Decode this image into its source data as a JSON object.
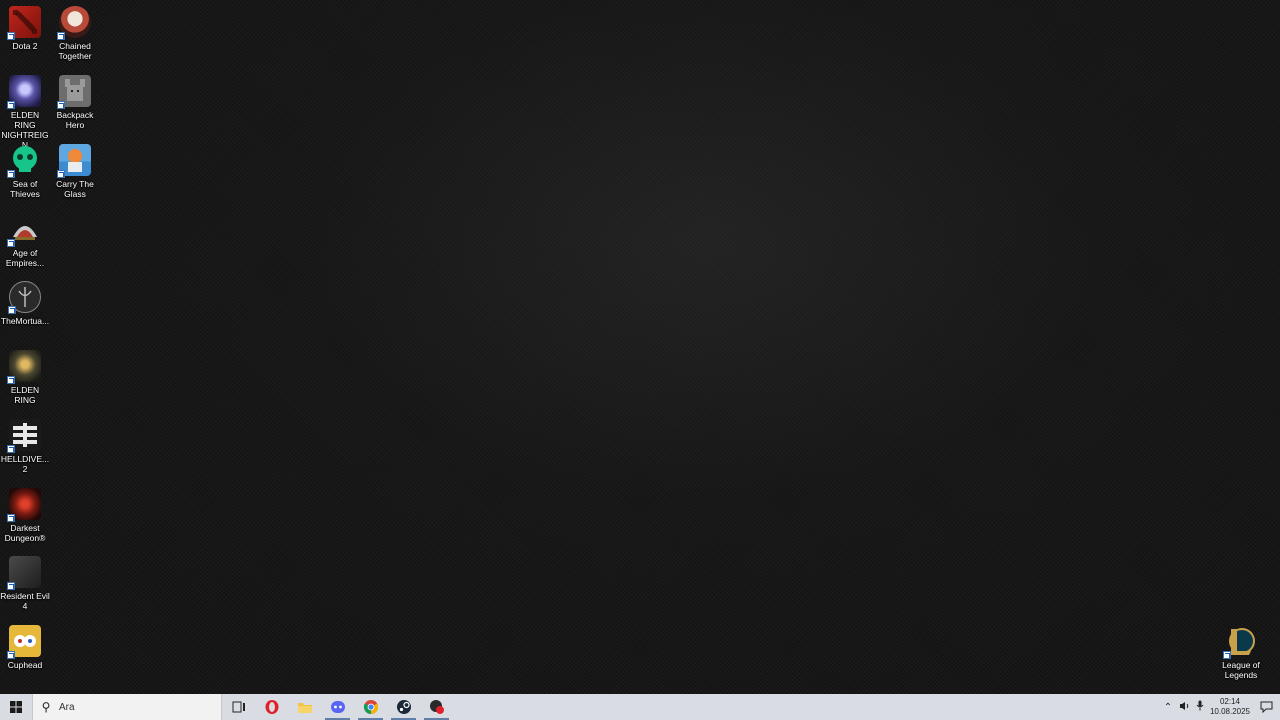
{
  "desktop_icons": [
    {
      "id": "dota2",
      "label": "Dota 2"
    },
    {
      "id": "chained",
      "label": "Chained Together"
    },
    {
      "id": "nightreign",
      "label": "ELDEN RING NIGHTREIGN"
    },
    {
      "id": "backpack",
      "label": "Backpack Hero"
    },
    {
      "id": "sot",
      "label": "Sea of Thieves"
    },
    {
      "id": "carry",
      "label": "Carry The Glass"
    },
    {
      "id": "aoe",
      "label": "Age of Empires..."
    },
    {
      "id": "mortuary",
      "label": "TheMortua..."
    },
    {
      "id": "eldenring",
      "label": "ELDEN RING"
    },
    {
      "id": "helldivers",
      "label": "HELLDIVE... 2"
    },
    {
      "id": "darkest",
      "label": "Darkest Dungeon®"
    },
    {
      "id": "re4",
      "label": "Resident Evil 4"
    },
    {
      "id": "cuphead",
      "label": "Cuphead"
    },
    {
      "id": "lol",
      "label": "League of Legends"
    }
  ],
  "taskbar": {
    "search_placeholder": "Ara",
    "pinned": [
      "task-view",
      "opera",
      "file-explorer",
      "discord",
      "chrome",
      "steam",
      "riot-client"
    ],
    "time": "02:14",
    "date": "10.08.2025"
  },
  "colors": {
    "taskbar_bg": "#d9dde3",
    "desktop_bg": "#131313"
  }
}
